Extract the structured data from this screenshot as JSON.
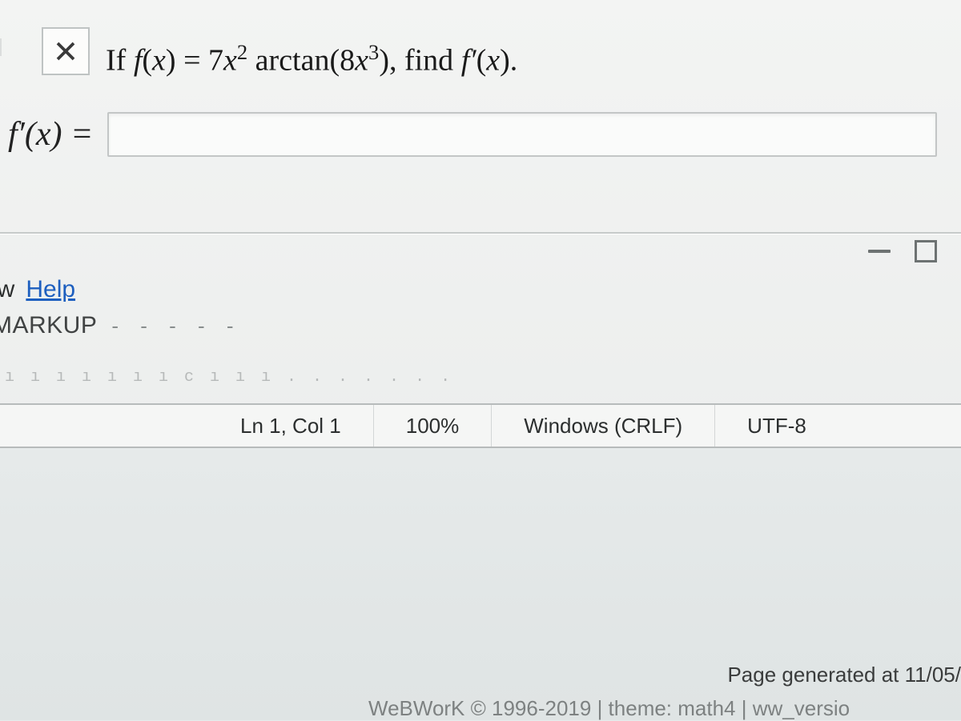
{
  "question": {
    "prefix": "If ",
    "func_name": "f",
    "func_arg": "x",
    "equals": " = ",
    "coeff": "7",
    "x2": "x",
    "x2_exp": "2",
    "arctan": " arctan(",
    "inner_coeff": "8",
    "x3": "x",
    "x3_exp": "3",
    "close": "), ",
    "find": "find ",
    "fprime": "f′",
    "fprime_arg": "x",
    "period": "."
  },
  "answer": {
    "label_f": "f′",
    "label_arg": "x",
    "label_eq": " ="
  },
  "menu": {
    "ew": "ew",
    "help": "Help",
    "markup": "MARKUP",
    "dashes": "- - - - -"
  },
  "editor_status": {
    "position": "Ln 1, Col 1",
    "zoom": "100%",
    "eol": "Windows (CRLF)",
    "encoding": "UTF-8"
  },
  "footer": {
    "page_generated": "Page generated at 11/05/",
    "credit": "WeBWorK © 1996-2019 | theme: math4 | ww_versio"
  },
  "ruler": "ı  ı    ı     ı  ı    ı  ı  c      ı      ı      ı            .  .           .        .  .       .        ."
}
